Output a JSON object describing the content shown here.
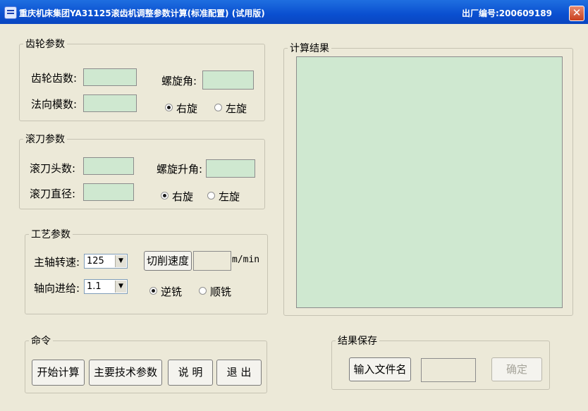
{
  "window": {
    "title": "重庆机床集团YA31125滚齿机调整参数计算(标准配置) (试用版)",
    "serial": "出厂编号:200609189",
    "close_glyph": "✕"
  },
  "gear_params": {
    "legend": "齿轮参数",
    "teeth_label": "齿轮齿数:",
    "module_label": "法向模数:",
    "helix_label": "螺旋角:",
    "right_label": "右旋",
    "left_label": "左旋",
    "teeth_value": "",
    "module_value": "",
    "helix_value": "",
    "hand_selected": "右旋"
  },
  "hob_params": {
    "legend": "滚刀参数",
    "starts_label": "滚刀头数:",
    "diameter_label": "滚刀直径:",
    "lead_angle_label": "螺旋升角:",
    "right_label": "右旋",
    "left_label": "左旋",
    "starts_value": "",
    "diameter_value": "",
    "lead_angle_value": "",
    "hand_selected": "右旋"
  },
  "process_params": {
    "legend": "工艺参数",
    "spindle_label": "主轴转速:",
    "spindle_value": "125",
    "feed_label": "轴向进给:",
    "feed_value": "1.1",
    "cut_speed_button": "切削速度",
    "cut_speed_value": "",
    "unit": "m/min",
    "up_label": "逆铣",
    "down_label": "顺铣",
    "mode_selected": "逆铣"
  },
  "commands": {
    "legend": "命令",
    "start": "开始计算",
    "params": "主要技术参数",
    "help": "说 明",
    "exit": "退 出"
  },
  "results": {
    "legend": "计算结果",
    "text": ""
  },
  "save": {
    "legend": "结果保存",
    "input_button": "输入文件名",
    "filename": "",
    "ok_button": "确定",
    "ok_enabled": false
  },
  "colors": {
    "title_bar": "#0a4fd0",
    "dialog_bg": "#ece9d8",
    "field_bg": "#cfe8d0",
    "close": "#c8401e"
  },
  "icons": {
    "app": "app-icon",
    "close": "close-icon",
    "dropdown": "chevron-down-icon"
  }
}
